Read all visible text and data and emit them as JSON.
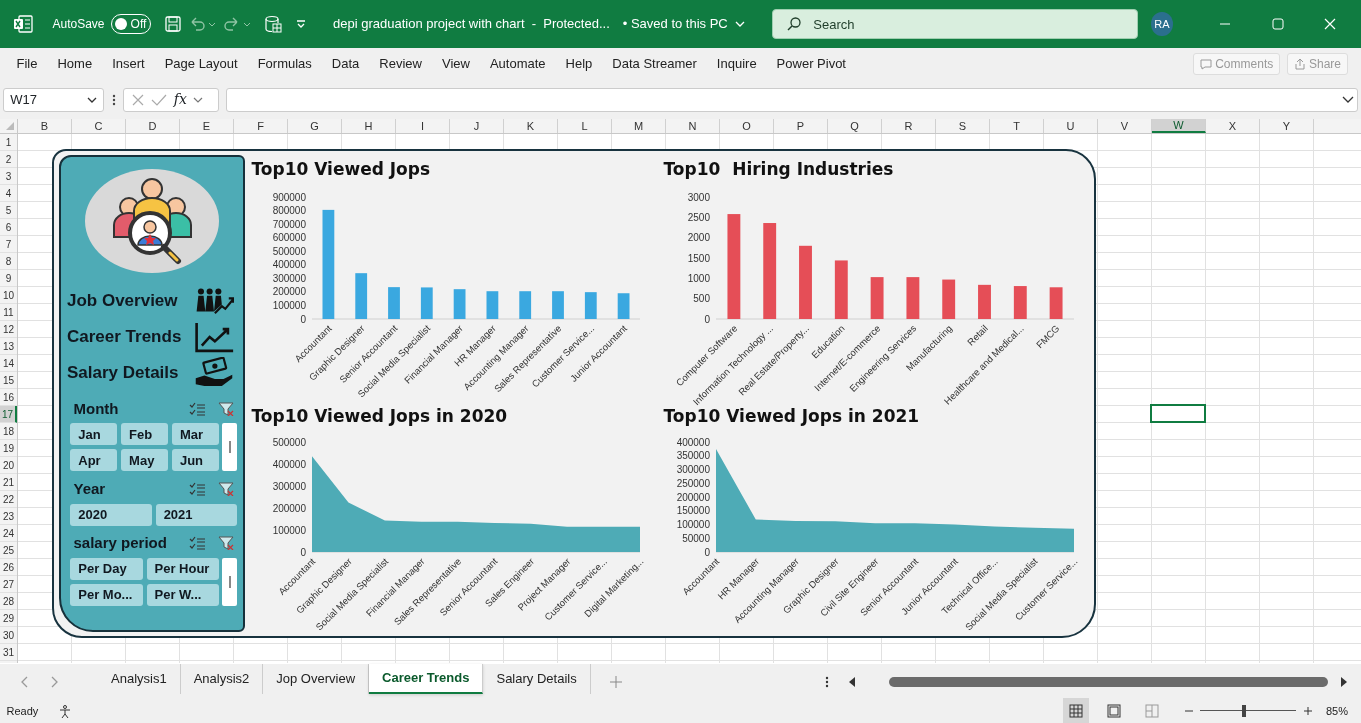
{
  "title_bar": {
    "autosave_label": "AutoSave",
    "autosave": {
      "label": "Off",
      "on": false
    },
    "document_title": "depi graduation project with chart  -  Protected...",
    "save_status": "• Saved to this PC",
    "search": {
      "placeholder": "Search"
    },
    "user_initials": "RA"
  },
  "ribbon_tabs": [
    "File",
    "Home",
    "Insert",
    "Page Layout",
    "Formulas",
    "Data",
    "Review",
    "View",
    "Automate",
    "Help",
    "Data Streamer",
    "Inquire",
    "Power Pivot"
  ],
  "ribbon_actions": [
    {
      "label": "Comments",
      "disabled": true
    },
    {
      "label": "Share",
      "disabled": true
    }
  ],
  "formula_bar": {
    "name_box": "W17",
    "fx_label": "fx"
  },
  "sheet": {
    "columns": [
      {
        "label": "B",
        "selected": false
      },
      {
        "label": "C",
        "selected": false
      },
      {
        "label": "D",
        "selected": false
      },
      {
        "label": "E",
        "selected": false
      },
      {
        "label": "F",
        "selected": false
      },
      {
        "label": "G",
        "selected": false
      },
      {
        "label": "H",
        "selected": false
      },
      {
        "label": "I",
        "selected": false
      },
      {
        "label": "J",
        "selected": false
      },
      {
        "label": "K",
        "selected": false
      },
      {
        "label": "L",
        "selected": false
      },
      {
        "label": "M",
        "selected": false
      },
      {
        "label": "N",
        "selected": false
      },
      {
        "label": "O",
        "selected": false
      },
      {
        "label": "P",
        "selected": false
      },
      {
        "label": "Q",
        "selected": false
      },
      {
        "label": "R",
        "selected": false
      },
      {
        "label": "S",
        "selected": false
      },
      {
        "label": "T",
        "selected": false
      },
      {
        "label": "U",
        "selected": false
      },
      {
        "label": "V",
        "selected": false
      },
      {
        "label": "W",
        "selected": true
      },
      {
        "label": "X",
        "selected": false
      },
      {
        "label": "Y",
        "selected": false
      }
    ],
    "rows": [
      {
        "label": "1",
        "selected": false
      },
      {
        "label": "2",
        "selected": false
      },
      {
        "label": "3",
        "selected": false
      },
      {
        "label": "4",
        "selected": false
      },
      {
        "label": "5",
        "selected": false
      },
      {
        "label": "6",
        "selected": false
      },
      {
        "label": "7",
        "selected": false
      },
      {
        "label": "8",
        "selected": false
      },
      {
        "label": "9",
        "selected": false
      },
      {
        "label": "10",
        "selected": false
      },
      {
        "label": "11",
        "selected": false
      },
      {
        "label": "12",
        "selected": false
      },
      {
        "label": "13",
        "selected": false
      },
      {
        "label": "14",
        "selected": false
      },
      {
        "label": "15",
        "selected": false
      },
      {
        "label": "16",
        "selected": false
      },
      {
        "label": "17",
        "selected": true
      },
      {
        "label": "18",
        "selected": false
      },
      {
        "label": "19",
        "selected": false
      },
      {
        "label": "20",
        "selected": false
      },
      {
        "label": "21",
        "selected": false
      },
      {
        "label": "22",
        "selected": false
      },
      {
        "label": "23",
        "selected": false
      },
      {
        "label": "24",
        "selected": false
      },
      {
        "label": "25",
        "selected": false
      },
      {
        "label": "26",
        "selected": false
      },
      {
        "label": "27",
        "selected": false
      },
      {
        "label": "28",
        "selected": false
      },
      {
        "label": "29",
        "selected": false
      },
      {
        "label": "30",
        "selected": false
      },
      {
        "label": "31",
        "selected": false
      }
    ]
  },
  "dashboard": {
    "nav": [
      {
        "label": "Job Overview",
        "kind": "people"
      },
      {
        "label": "Career Trends",
        "kind": "trend"
      },
      {
        "label": "Salary Details",
        "kind": "money"
      }
    ],
    "slicers": [
      {
        "title": "Month",
        "kind": "grid3",
        "scrollbar": true,
        "items": [
          {
            "label": "Jan",
            "selected": true
          },
          {
            "label": "Feb",
            "selected": true
          },
          {
            "label": "Mar",
            "selected": true
          },
          {
            "label": "Apr",
            "selected": true
          },
          {
            "label": "May",
            "selected": true
          },
          {
            "label": "Jun",
            "selected": true
          }
        ]
      },
      {
        "title": "Year",
        "kind": "grid2",
        "scrollbar": false,
        "items": [
          {
            "label": "2020",
            "selected": true
          },
          {
            "label": "2021",
            "selected": true
          }
        ]
      },
      {
        "title": "salary period",
        "kind": "grid2",
        "scrollbar": true,
        "items": [
          {
            "label": "Per Day",
            "selected": true
          },
          {
            "label": "Per Hour",
            "selected": true
          },
          {
            "label": "Per Mo...",
            "selected": true
          },
          {
            "label": "Per W...",
            "selected": true
          }
        ]
      }
    ],
    "charts": [
      {
        "chart_data": {
          "type": "bar",
          "title": "Top10 Viewed Jops",
          "categories": [
            "Accountant",
            "Graphic Designer",
            "Senior Accountant",
            "Social Media Specialist",
            "Financial Manager",
            "HR Manager",
            "Accounting Manager",
            "Sales Representative",
            "Customer Service...",
            "Junior Accountant"
          ],
          "series": [
            {
              "color": "#3aa8e0",
              "values": [
                805000,
                338000,
                235000,
                233000,
                220000,
                205000,
                205000,
                205000,
                198000,
                190000
              ]
            }
          ],
          "ylim": [
            0,
            900000
          ],
          "yticks": [
            0,
            100000,
            200000,
            300000,
            400000,
            500000,
            600000,
            700000,
            800000,
            900000
          ]
        }
      },
      {
        "chart_data": {
          "type": "bar",
          "title": "Top10  Hiring Industries",
          "categories": [
            "Computer Software",
            "Information Technology ...",
            "Real Estate/Property...",
            "Education",
            "Internet/E-commerce",
            "Engineering Services",
            "Manufacturing",
            "Retail",
            "Healthcare and Medical...",
            "FMCG"
          ],
          "series": [
            {
              "color": "#e54e57",
              "values": [
                2580,
                2360,
                1800,
                1440,
                1030,
                1030,
                970,
                840,
                810,
                780
              ]
            }
          ],
          "ylim": [
            0,
            3000
          ],
          "yticks": [
            0,
            500,
            1000,
            1500,
            2000,
            2500,
            3000
          ]
        }
      },
      {
        "chart_data": {
          "type": "area",
          "title": "Top10 Viewed Jops in 2020",
          "categories": [
            "Accountant",
            "Graphic Designer",
            "Social Media Specialist",
            "Financial Manager",
            "Sales Representative",
            "Senior Accountant",
            "Sales Engineer",
            "Project Manager",
            "Customer Service...",
            "Digital Marketing..."
          ],
          "series": [
            {
              "color": "#4eabb6",
              "values": [
                435000,
                225000,
                143000,
                138000,
                137000,
                132000,
                128000,
                115000,
                115000,
                115000
              ]
            }
          ],
          "ylim": [
            0,
            500000
          ],
          "yticks": [
            0,
            100000,
            200000,
            300000,
            400000,
            500000
          ]
        }
      },
      {
        "chart_data": {
          "type": "area",
          "title": "Top10 Viewed Jops in 2021",
          "categories": [
            "Accountant",
            "HR Manager",
            "Accounting Manager",
            "Graphic Designer",
            "Civil Site Engineer",
            "Senior Accountant",
            "Junior Accountant",
            "Technical Office...",
            "Social Media Specialist",
            "Customer Service..."
          ],
          "series": [
            {
              "color": "#4eabb6",
              "values": [
                375000,
                118000,
                113000,
                112000,
                105000,
                105000,
                100000,
                93000,
                88000,
                85000
              ]
            }
          ],
          "ylim": [
            0,
            400000
          ],
          "yticks": [
            0,
            50000,
            100000,
            150000,
            200000,
            250000,
            300000,
            350000,
            400000
          ]
        }
      }
    ]
  },
  "sheet_tabs": [
    {
      "label": "Analysis1",
      "selected": false
    },
    {
      "label": "Analysis2",
      "selected": false
    },
    {
      "label": "Jop Overview",
      "selected": false
    },
    {
      "label": "Career Trends",
      "selected": true
    },
    {
      "label": "Salary Details",
      "selected": false
    }
  ],
  "status_bar": {
    "status": "Ready",
    "zoom": {
      "level": 0.45,
      "reading": "85%"
    }
  }
}
